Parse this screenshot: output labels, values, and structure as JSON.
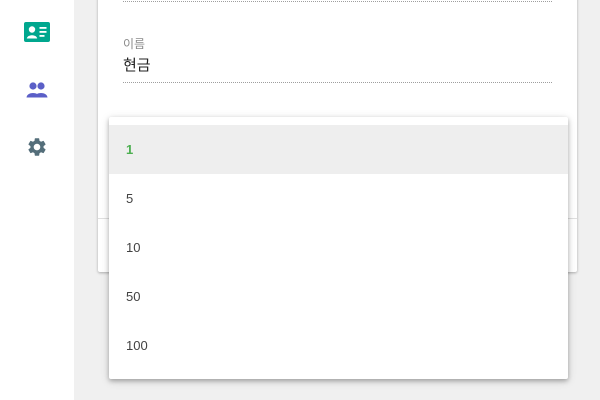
{
  "sidebar": {
    "items": [
      {
        "icon": "contact-card-icon",
        "color": "#00a78e"
      },
      {
        "icon": "people-icon",
        "color": "#5b5fc7"
      },
      {
        "icon": "gear-icon",
        "color": "#546e7a"
      }
    ]
  },
  "form": {
    "name_field": {
      "label": "이름",
      "value": "현금"
    }
  },
  "dropdown": {
    "options": [
      {
        "label": "1",
        "selected": true
      },
      {
        "label": "5",
        "selected": false
      },
      {
        "label": "10",
        "selected": false
      },
      {
        "label": "50",
        "selected": false
      },
      {
        "label": "100",
        "selected": false
      }
    ],
    "selected_color": "#4caf50",
    "highlight_color": "#eeeeee"
  }
}
